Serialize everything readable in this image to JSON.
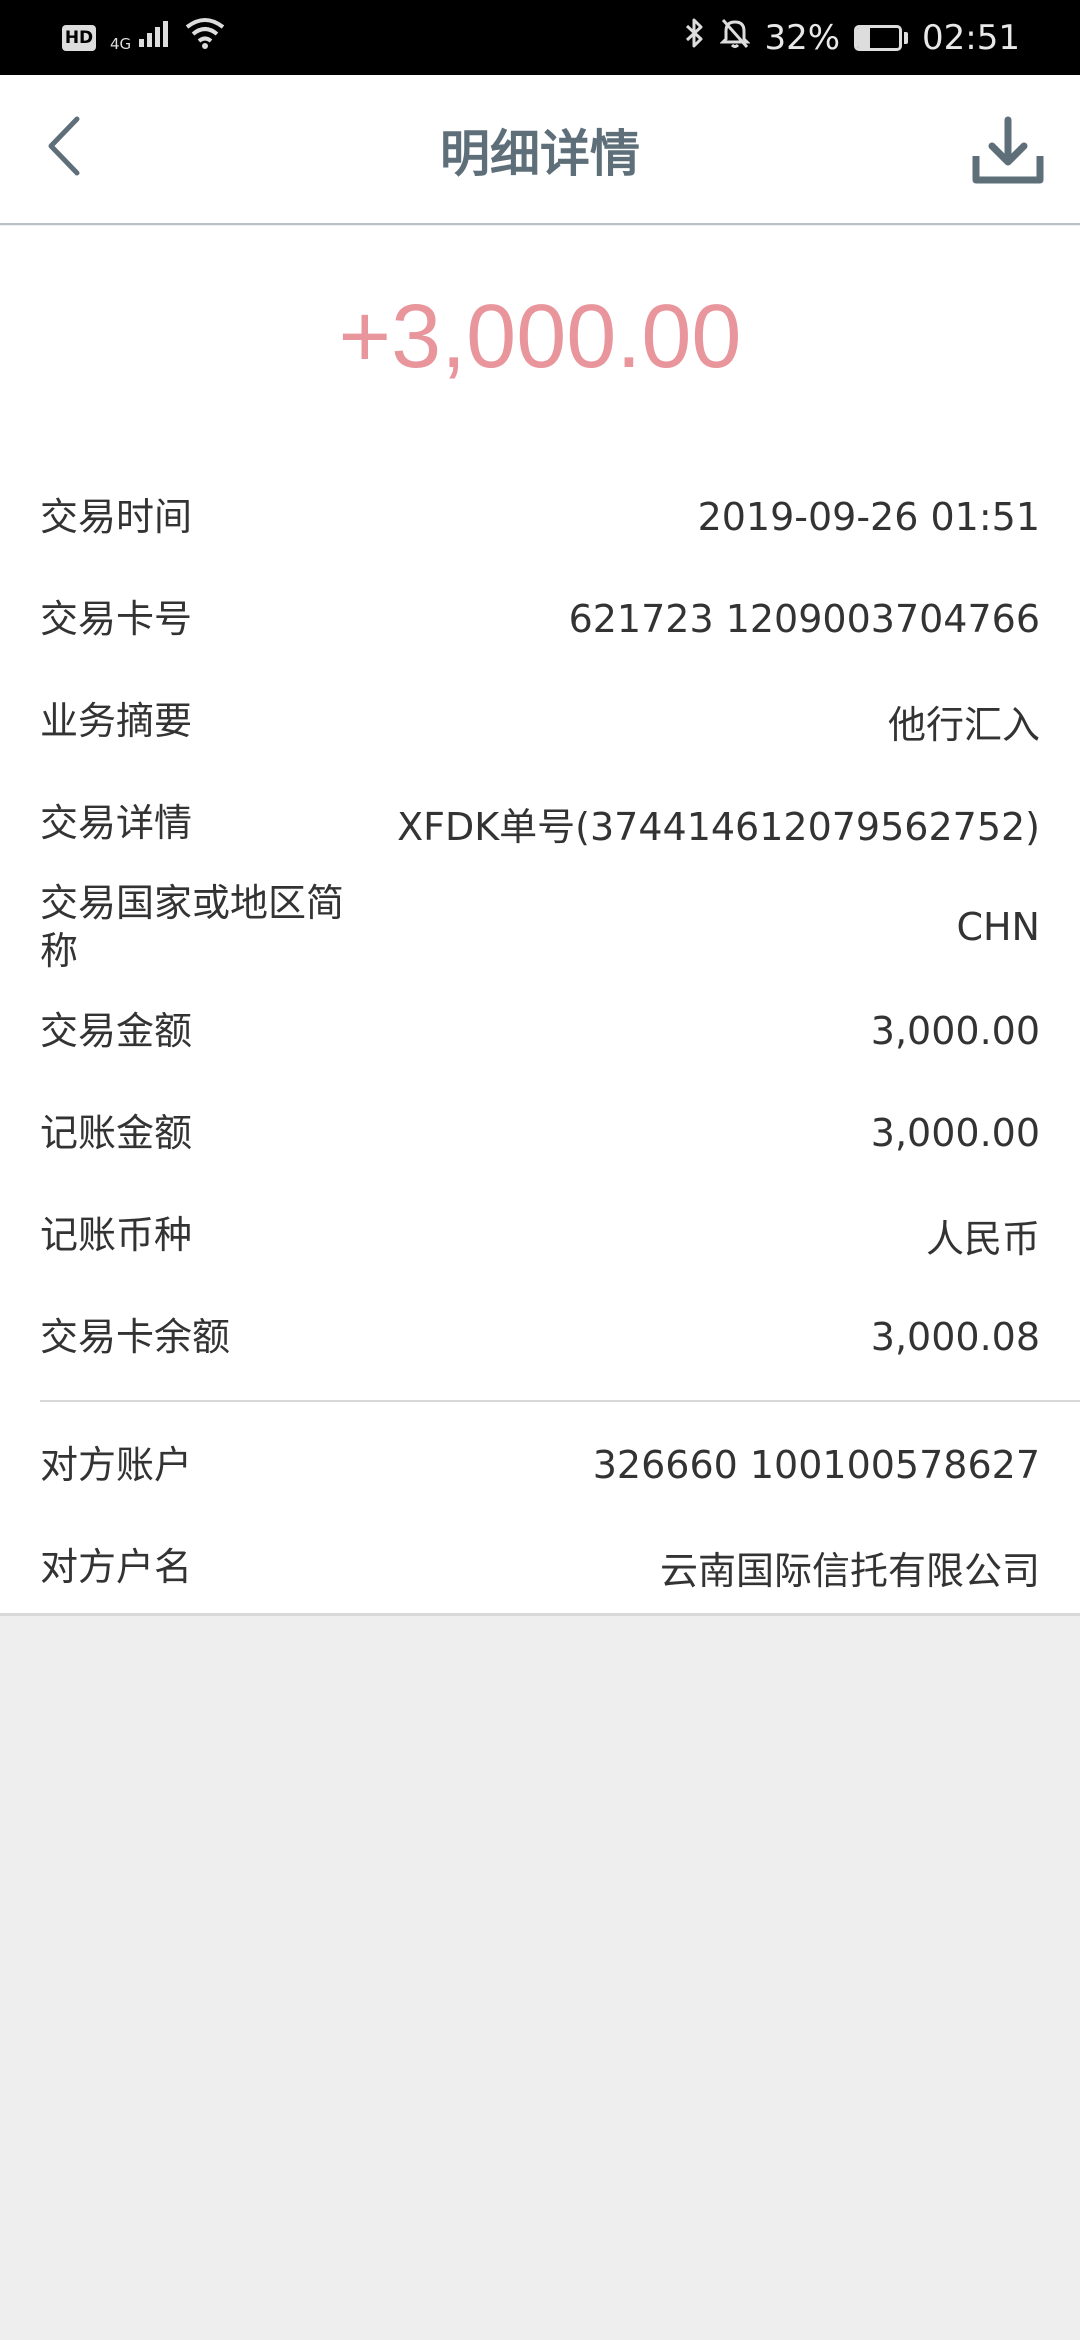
{
  "status_bar": {
    "hd": "HD",
    "network": "4G",
    "battery_percent": "32%",
    "battery_level": 0.32,
    "time": "02:51",
    "icons": [
      "signal-icon",
      "wifi-icon",
      "bluetooth-icon",
      "mute-icon",
      "battery-icon"
    ]
  },
  "header": {
    "title": "明细详情",
    "back_icon": "chevron-left-icon",
    "download_icon": "download-icon"
  },
  "amount": "+3,000.00",
  "details": [
    {
      "label": "交易时间",
      "value": "2019-09-26 01:51"
    },
    {
      "label": "交易卡号",
      "value": "621723 1209003704766"
    },
    {
      "label": "业务摘要",
      "value": "他行汇入"
    },
    {
      "label": "交易详情",
      "value": "XFDK单号(374414612079562752)"
    },
    {
      "label": "交易国家或地区简称",
      "value": "CHN"
    },
    {
      "label": "交易金额",
      "value": "3,000.00"
    },
    {
      "label": "记账金额",
      "value": "3,000.00"
    },
    {
      "label": "记账币种",
      "value": "人民币"
    },
    {
      "label": "交易卡余额",
      "value": "3,000.08"
    }
  ],
  "counterparty": [
    {
      "label": "对方账户",
      "value": "326660 100100578627"
    },
    {
      "label": "对方户名",
      "value": "云南国际信托有限公司"
    }
  ],
  "colors": {
    "amount": "#e8959c",
    "title": "#5e6f7a",
    "icon": "#5e6f7a",
    "background": "#eeeeee"
  }
}
